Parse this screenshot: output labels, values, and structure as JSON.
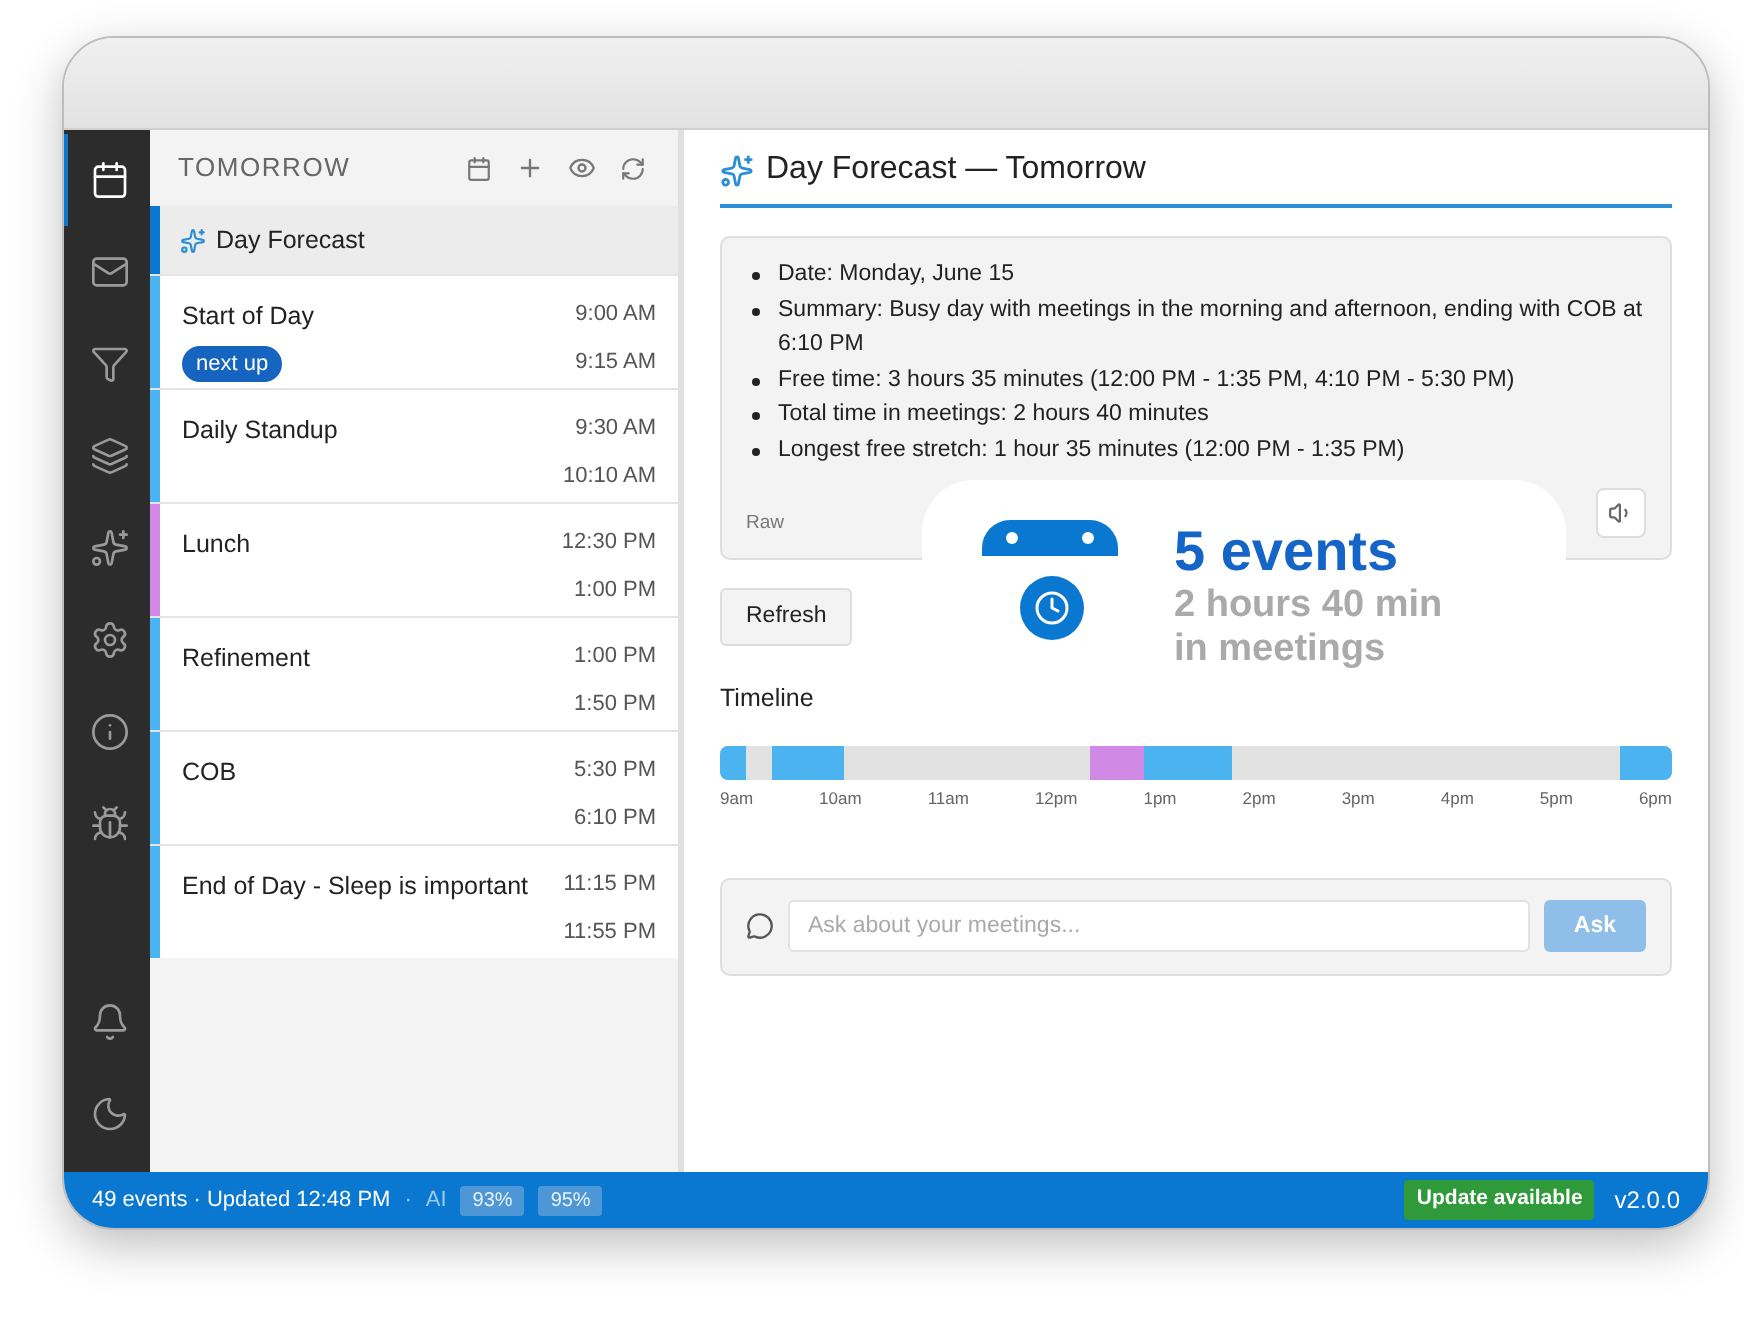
{
  "sidebar": {
    "top_items": [
      {
        "selected": true
      },
      {
        "selected": false
      },
      {
        "selected": false
      },
      {
        "selected": false
      },
      {
        "selected": false
      },
      {
        "selected": false
      },
      {
        "selected": false
      },
      {
        "selected": false
      }
    ],
    "bottom_items": [
      {
        "selected": false
      },
      {
        "selected": false
      }
    ]
  },
  "event_list": {
    "title": "TOMORROW",
    "forecast_item": {
      "label": "Day Forecast",
      "selected": true
    },
    "events": [
      {
        "title": "Start of Day",
        "start": "9:00 AM",
        "end": "9:15 AM",
        "badge": "next up",
        "color": "#4ab3f0"
      },
      {
        "title": "Daily Standup",
        "start": "9:30 AM",
        "end": "10:10 AM",
        "color": "#4ab3f0"
      },
      {
        "title": "Lunch",
        "start": "12:30 PM",
        "end": "1:00 PM",
        "color": "#d08ae6"
      },
      {
        "title": "Refinement",
        "start": "1:00 PM",
        "end": "1:50 PM",
        "color": "#4ab3f0"
      },
      {
        "title": "COB",
        "start": "5:30 PM",
        "end": "6:10 PM",
        "color": "#4ab3f0"
      },
      {
        "title": "End of Day - Sleep is important",
        "start": "11:15 PM",
        "end": "11:55 PM",
        "color": "#4ab3f0"
      }
    ]
  },
  "forecast": {
    "title": "Day Forecast — Tomorrow",
    "summary": [
      "Date: Monday, June 15",
      "Summary: Busy day with meetings in the morning and afternoon, ending with COB at 6:10 PM",
      "Free time: 3 hours 35 minutes (12:00 PM - 1:35 PM, 4:10 PM - 5:30 PM)",
      "Total time in meetings: 2 hours 40 minutes",
      "Longest free stretch: 1 hour 35 minutes (12:00 PM - 1:35 PM)"
    ],
    "raw_label": "Raw",
    "refresh_button": "Refresh",
    "timeline_title": "Timeline",
    "timeline_ticks": [
      "9am",
      "10am",
      "11am",
      "12pm",
      "1pm",
      "2pm",
      "3pm",
      "4pm",
      "5pm",
      "6pm"
    ],
    "ask": {
      "placeholder": "Ask about your meetings...",
      "button": "Ask"
    }
  },
  "overlay": {
    "headline": "5 events",
    "line_1": "2 hours 40 min",
    "line_2": "in meetings"
  },
  "status_bar": {
    "summary": "49 events · Updated 12:48 PM",
    "separator": "·",
    "ai_label": "AI",
    "badges": [
      "93%",
      "95%"
    ],
    "update": "Update available",
    "version": "v2.0.0"
  }
}
